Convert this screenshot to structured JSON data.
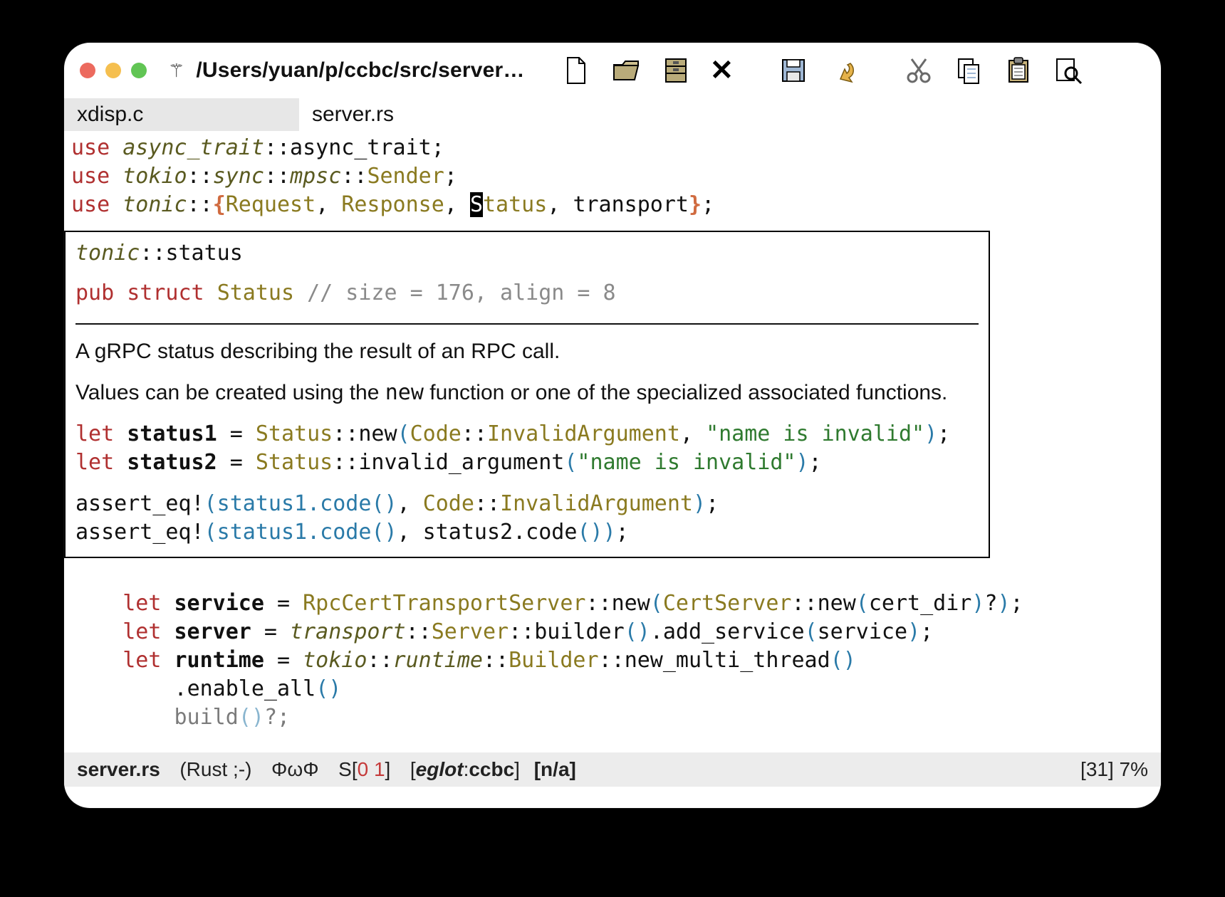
{
  "window": {
    "vc_indicator": "⚚",
    "title_path": "/Users/yuan/p/ccbc/src/server…"
  },
  "toolbar": {
    "icons": [
      "new-file-icon",
      "open-folder-icon",
      "archive-icon",
      "close-icon",
      "save-icon",
      "undo-icon",
      "cut-icon",
      "copy-icon",
      "paste-icon",
      "search-icon"
    ]
  },
  "tabs": {
    "inactive": "xdisp.c",
    "active": "server.rs"
  },
  "code": {
    "l1": {
      "use": "use",
      "mod": "async_trait",
      "rest": "::async_trait;"
    },
    "l2": {
      "use": "use",
      "mod": "tokio",
      "p1": "::",
      "mod2": "sync",
      "p2": "::",
      "mod3": "mpsc",
      "p3": "::",
      "ty": "Sender",
      "semi": ";"
    },
    "l3": {
      "use": "use",
      "mod": "tonic",
      "p1": "::",
      "lb": "{",
      "t1": "Request",
      "c1": ", ",
      "t2": "Response",
      "c2": ", ",
      "cursor": "S",
      "t3rest": "tatus",
      "c3": ", ",
      "t4": "transport",
      "rb": "}",
      "semi": ";"
    }
  },
  "hover": {
    "path": {
      "mod": "tonic",
      "sep": "::",
      "name": "status"
    },
    "sig": {
      "pub": "pub",
      "struct": "struct",
      "name": "Status",
      "meta": "// size = 176, align = 8"
    },
    "doc1": "A gRPC status describing the result of an RPC call.",
    "doc2a": "Values can be created using the ",
    "doc2_code": "new",
    "doc2b": " function or one of the specialized associated functions.",
    "ex1": {
      "let": "let",
      "v": "status1",
      "eq": " = ",
      "t": "Status",
      "sep": "::",
      "fn": "new",
      "open": "(",
      "a1": "Code",
      "a1sep": "::",
      "a1m": "InvalidArgument",
      "c": ", ",
      "s": "\"name is invalid\"",
      "close": ")",
      "semi": ";"
    },
    "ex2": {
      "let": "let",
      "v": "status2",
      "eq": " = ",
      "t": "Status",
      "sep": "::",
      "fn": "invalid_argument",
      "open": "(",
      "s": "\"name is invalid\"",
      "close": ")",
      "semi": ";"
    },
    "ex3": "assert_eq!",
    "ex3a": "(status1.code",
    "ex3p": "()",
    "ex3c": ", ",
    "ex3t": "Code",
    "ex3sep": "::",
    "ex3m": "InvalidArgument",
    "ex3close": ")",
    "ex3semi": ";",
    "ex4": "assert_eq!",
    "ex4a": "(status1.code",
    "ex4p": "()",
    "ex4c": ", status2.code",
    "ex4p2": "()",
    "ex4close": ")",
    "ex4semi": ";"
  },
  "after": {
    "l1": {
      "pad": "    ",
      "let": "let",
      "sp": " ",
      "v": "service",
      "eq": " = ",
      "t1": "RpcCertTransportServer",
      "sep": "::",
      "fn1": "new",
      "op": "(",
      "t2": "CertServer",
      "sep2": "::",
      "fn2": "new",
      "op2": "(",
      "arg": "cert_dir",
      "close2": ")",
      "q": "?",
      "close": ")",
      "semi": ";"
    },
    "l2": {
      "pad": "    ",
      "let": "let",
      "sp": " ",
      "v": "server",
      "eq": " = ",
      "m": "transport",
      "sep": "::",
      "t": "Server",
      "sep2": "::",
      "fn": "builder",
      "p": "()",
      "dot": ".",
      "fn2": "add_service",
      "op": "(",
      "arg": "service",
      "close": ")",
      "semi": ";"
    },
    "l3": {
      "pad": "    ",
      "let": "let",
      "sp": " ",
      "v": "runtime",
      "eq": " = ",
      "m1": "tokio",
      "s1": "::",
      "m2": "runtime",
      "s2": "::",
      "t": "Builder",
      "s3": "::",
      "fn": "new_multi_thread",
      "p": "()"
    },
    "l4": {
      "pad": "        ",
      "dot": ".",
      "fn": "enable_all",
      "p": "()"
    },
    "l5": {
      "pad": "        ",
      "fn": "build",
      "p": "()",
      "q": "?",
      "semi": ";"
    }
  },
  "modeline": {
    "file": "server.rs",
    "mode": "(Rust ;-)",
    "flymake_label": "ΦωΦ",
    "flymake_s": "S",
    "flymake_lb": "[",
    "flymake_err": "0",
    "flymake_warn": "1",
    "flymake_rb": "]",
    "eglot_lb": "[",
    "eglot_name": "eglot",
    "eglot_sep": ":",
    "eglot_proj": "ccbc",
    "eglot_rb": "]",
    "na": "[n/a]",
    "lineinfo_lb": "[",
    "lineinfo": "31",
    "lineinfo_rb": "]",
    "percent": "7%"
  }
}
